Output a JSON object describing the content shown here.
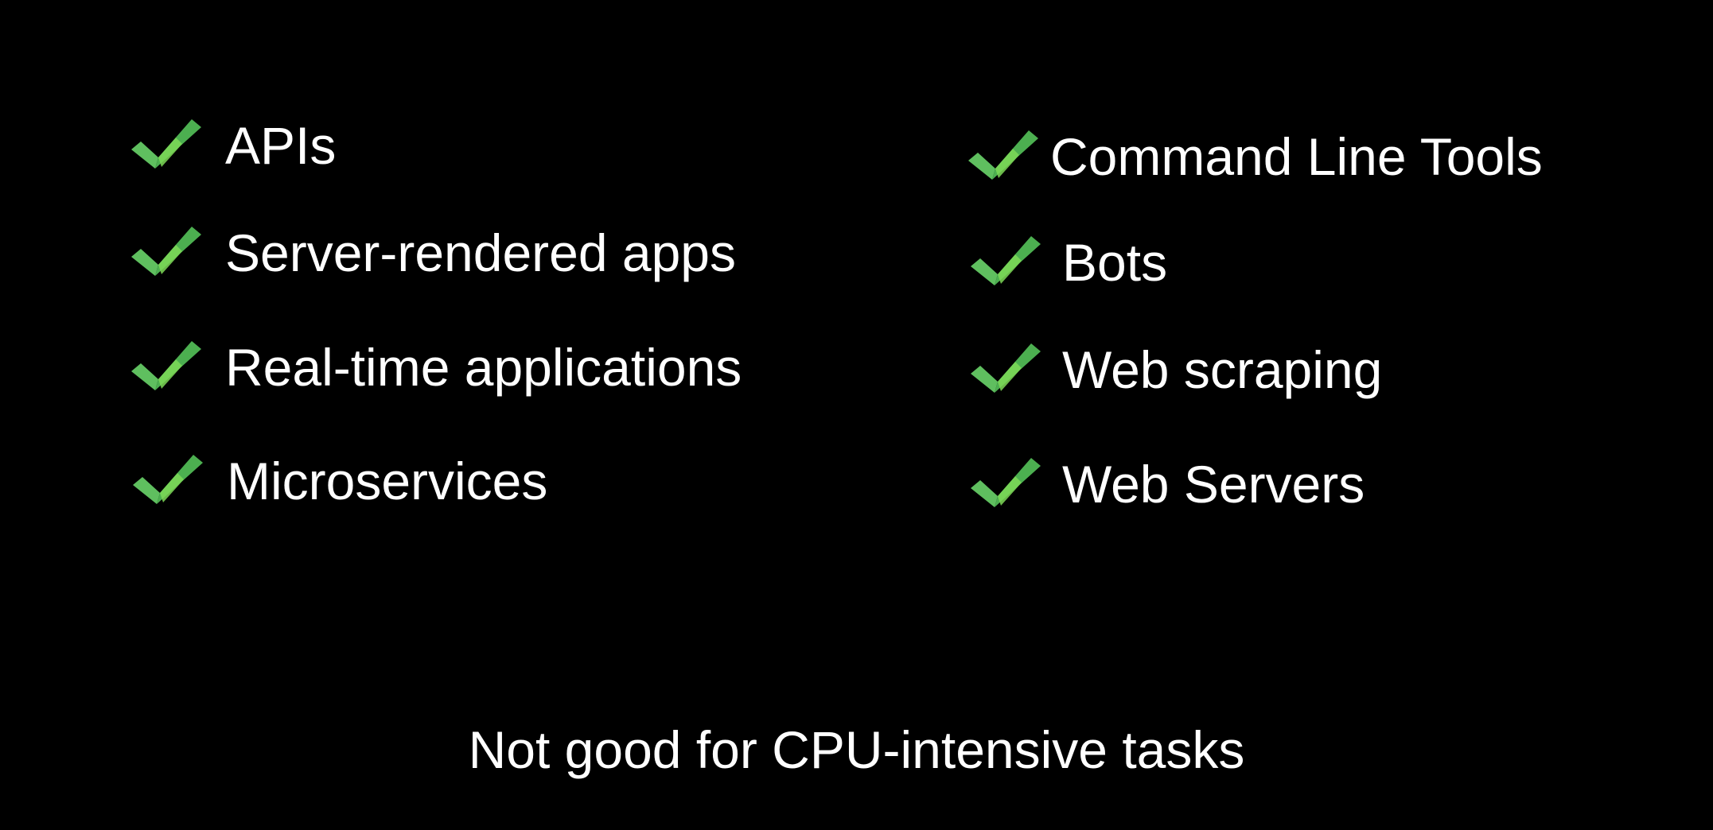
{
  "slide": {
    "background_color": "#000000",
    "text_color": "#ffffff",
    "check_colors": {
      "dark": "#3fa34d",
      "light": "#7ed957"
    },
    "left_items": [
      {
        "icon": "check-icon",
        "label": "APIs"
      },
      {
        "icon": "check-icon",
        "label": "Server-rendered apps"
      },
      {
        "icon": "check-icon",
        "label": "Real-time applications"
      },
      {
        "icon": "check-icon",
        "label": "Microservices"
      }
    ],
    "right_items": [
      {
        "icon": "check-icon",
        "label": "Command Line Tools"
      },
      {
        "icon": "check-icon",
        "label": "Bots"
      },
      {
        "icon": "check-icon",
        "label": "Web scraping"
      },
      {
        "icon": "check-icon",
        "label": "Web Servers"
      }
    ],
    "footer": "Not good for CPU-intensive tasks"
  }
}
